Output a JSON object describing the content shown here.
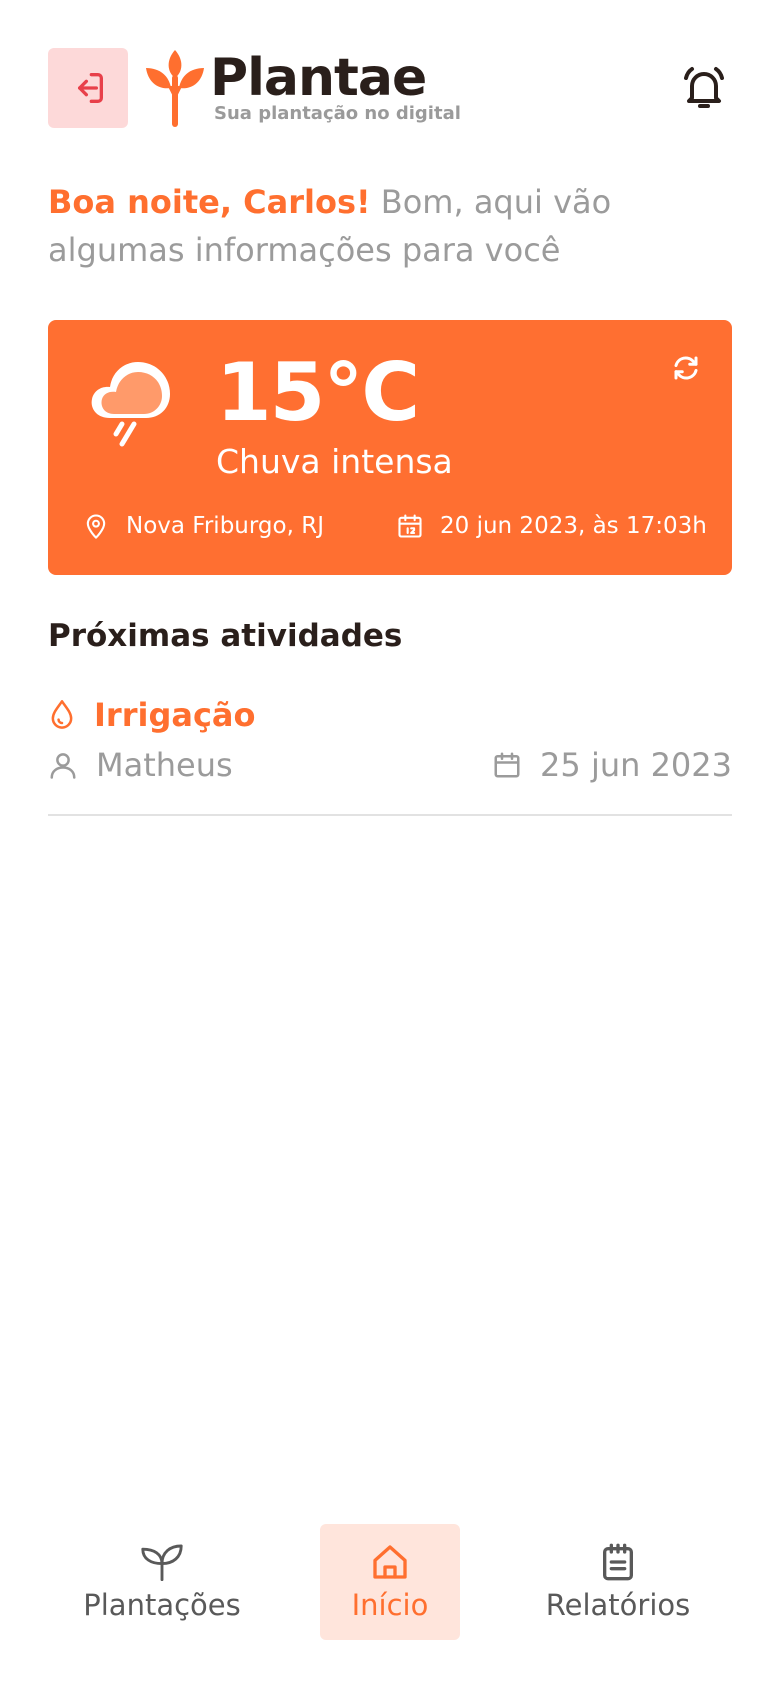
{
  "header": {
    "logo_title": "Plantae",
    "logo_tagline": "Sua plantação no digital"
  },
  "greeting": {
    "hello": "Boa noite, Carlos!",
    "message": " Bom, aqui vão algumas informações para você"
  },
  "weather": {
    "temperature": "15°C",
    "condition": "Chuva intensa",
    "location": "Nova Friburgo, RJ",
    "datetime": "20 jun 2023, às 17:03h"
  },
  "activities": {
    "section_title": "Próximas atividades",
    "items": [
      {
        "title": "Irrigação",
        "user": "Matheus",
        "date": "25 jun 2023"
      }
    ]
  },
  "nav": {
    "items": [
      {
        "label": "Plantações",
        "icon": "sprout-icon"
      },
      {
        "label": "Início",
        "icon": "home-icon",
        "active": true
      },
      {
        "label": "Relatórios",
        "icon": "clipboard-icon"
      }
    ]
  },
  "colors": {
    "accent": "#ff6f31",
    "accent_soft": "#ffe5dc",
    "logout_bg": "#fdd9d9",
    "logout_icon": "#e8404a",
    "text_dark": "#2a1f1b",
    "text_muted": "#9b9b9b"
  }
}
